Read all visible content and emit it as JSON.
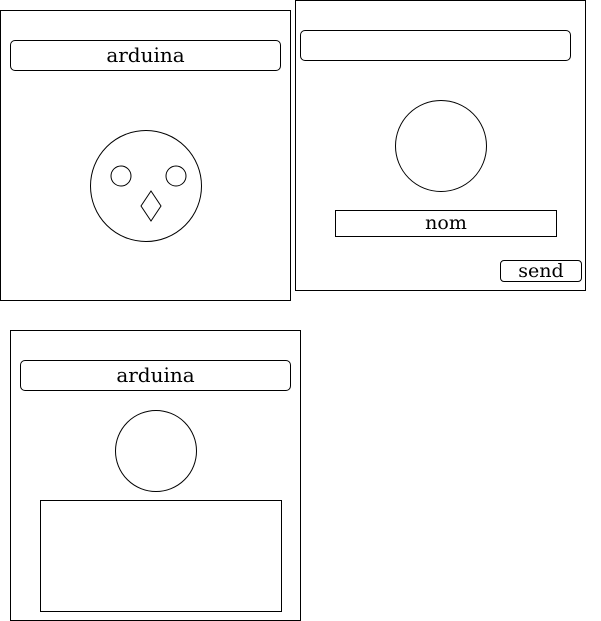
{
  "profile_card": {
    "title": "arduina",
    "avatar_icon": "owl-face-icon"
  },
  "edit_card": {
    "title_input_value": "",
    "avatar_icon": "avatar-placeholder-icon",
    "name_field_value": "nom",
    "send_label": "send"
  },
  "message_card": {
    "title": "arduina",
    "avatar_icon": "avatar-placeholder-icon",
    "message_value": ""
  },
  "colors": {
    "stroke": "#000000",
    "background": "#ffffff"
  }
}
